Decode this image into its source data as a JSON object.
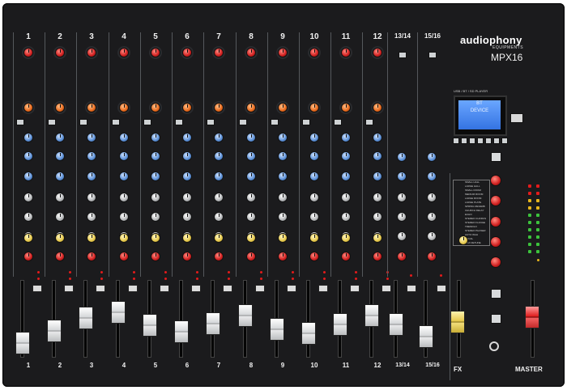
{
  "brand": {
    "name": "audiophony",
    "sub": "EQUIPMENTS",
    "model": "MPX16"
  },
  "display": {
    "header": "USB / BT / SD PLAYER",
    "line1": "BT",
    "line2": "DEVICE"
  },
  "channels": [
    "1",
    "2",
    "3",
    "4",
    "5",
    "6",
    "7",
    "8",
    "9",
    "10",
    "11",
    "12",
    "13/14",
    "15/16"
  ],
  "fx_label": "FX",
  "master_label": "MASTER",
  "fx_presets": [
    "SMALL HALL",
    "LARGE HALL",
    "SMALL ROOM",
    "MEDIUM ROOM",
    "LARGE ROOM",
    "LARGE PLATE",
    "SPRING REVERB",
    "CHURCH DELAY",
    "ECHO",
    "STEREO CHORUS",
    "STEREO FLANGE",
    "TREMOLO",
    "STEREO PHASER",
    "AUTO WAH",
    "VOCAL",
    "MAX DETUNE"
  ],
  "colors": {
    "body": "#1b1b1d",
    "gain_knob": "#d01f1f",
    "comp_knob": "#e8691c",
    "eq_knob": "#5b8fd6",
    "aux_knob": "#b4b6b8",
    "fx_knob": "#e6c84b",
    "screen": "#3473e2",
    "fx_fader": "#e6c84b",
    "master_fader": "#e02020"
  }
}
